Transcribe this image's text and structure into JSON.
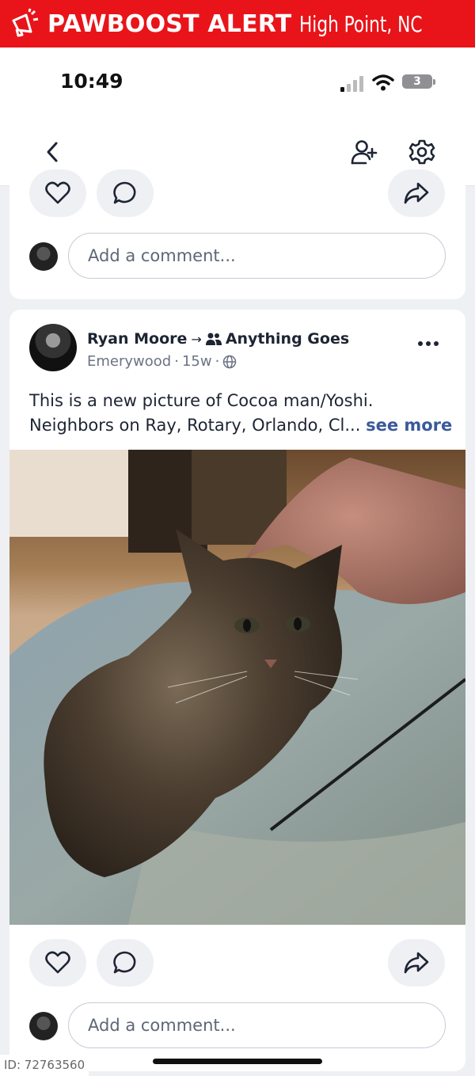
{
  "banner": {
    "brand": "PAWBOOST ALERT",
    "location": "High Point, NC",
    "color": "#e8141a"
  },
  "status": {
    "time": "10:49",
    "battery": "3"
  },
  "nav": {
    "back_icon": "chevron-left-icon",
    "add_friend_icon": "add-person-icon",
    "settings_icon": "gear-icon"
  },
  "previous_post": {
    "comment_placeholder": "Add a comment..."
  },
  "post": {
    "author": "Ryan Moore",
    "arrow": "→",
    "group": "Anything Goes",
    "location": "Emerywood",
    "age": "15w",
    "sep": "·",
    "text": "This is a new picture of Cocoa man/Yoshi. Neighbors on Ray, Rotary, Orlando, Cl...",
    "see_more": "see more",
    "photo_subject": "tabby cat",
    "comment_placeholder": "Add a comment..."
  },
  "watermark": "ID: 72763560"
}
